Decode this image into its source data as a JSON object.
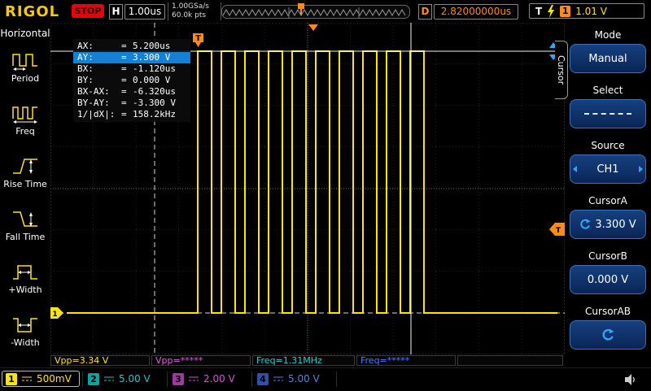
{
  "topbar": {
    "logo": "RIGOL",
    "run_state": "STOP",
    "h_label": "H",
    "timebase": "1.00us",
    "sample_rate": "1.00GSa/s",
    "mem_depth": "60.0k pts",
    "d_label": "D",
    "delay": "2.82000000us",
    "t_label": "T",
    "trigger_source": "1",
    "trigger_level": "1.01 V"
  },
  "sidebar": {
    "title": "Horizontal",
    "items": [
      {
        "label": "Period"
      },
      {
        "label": "Freq"
      },
      {
        "label": "Rise Time"
      },
      {
        "label": "Fall Time"
      },
      {
        "label": "+Width"
      },
      {
        "label": "-Width"
      }
    ]
  },
  "scope": {
    "trigger_flag_label": "T",
    "trigger_level_label": "T",
    "ch1_marker_label": "1"
  },
  "cursor_readout": {
    "eq": "=",
    "rows": [
      {
        "label": "AX:",
        "value": "5.200us"
      },
      {
        "label": "AY:",
        "value": "3.300 V"
      },
      {
        "label": "BX:",
        "value": "-1.120us"
      },
      {
        "label": "BY:",
        "value": "0.000 V"
      },
      {
        "label": "BX-AX:",
        "value": "-6.320us"
      },
      {
        "label": "BY-AY:",
        "value": "-3.300 V"
      },
      {
        "label": "1/|dX|:",
        "value": "158.2kHz"
      }
    ]
  },
  "right_menu": {
    "tab": "Cursor",
    "items": [
      {
        "label": "Mode",
        "value": "Manual"
      },
      {
        "label": "Select",
        "value": ""
      },
      {
        "label": "Source",
        "value": "CH1"
      },
      {
        "label": "CursorA",
        "value": "3.300 V"
      },
      {
        "label": "CursorB",
        "value": "0.000 V"
      },
      {
        "label": "CursorAB",
        "value": ""
      }
    ]
  },
  "measurements": [
    {
      "text": "Vpp=3.34 V"
    },
    {
      "text": "Vpp=*****"
    },
    {
      "text": "Freq=1.31MHz"
    },
    {
      "text": "Freq=*****"
    }
  ],
  "channels": [
    {
      "num": "1",
      "scale": "500mV"
    },
    {
      "num": "2",
      "scale": "5.00 V"
    },
    {
      "num": "3",
      "scale": "2.00 V"
    },
    {
      "num": "4",
      "scale": "5.00 V"
    }
  ],
  "colors": {
    "ch1": "#ffe600",
    "ch2": "#22d3d3",
    "ch3": "#e05ce0",
    "ch4": "#4a7dff",
    "accent_orange": "#ff8c1a",
    "cursor_highlight": "#1581d4",
    "menu_box_blue": "#0e2f6e"
  }
}
